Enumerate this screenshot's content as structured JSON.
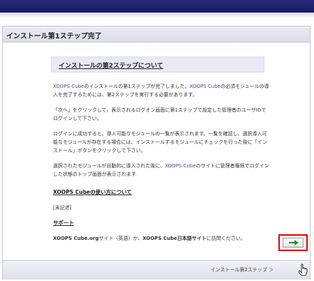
{
  "window": {
    "title": "インストール第1ステップ完了"
  },
  "main": {
    "section_heading": "インストールの第2ステップについて",
    "paragraph1": {
      "a": "XOOPS Cube",
      "b": "のインストールの第1ステップが完了しました。",
      "c": "XOOPS Cube",
      "d": "の必須モジュールの導入を完了するためには、第2ステップを実行する必要があります。"
    },
    "paragraph2": "「次へ」をクリックして、表示されるログオン画面に第1ステップで設定した管理者のユーザIDでログインして下さい。",
    "paragraph3": "ログインに成功すると、導入可能なモジュールの一覧が表示されます。一覧を確認し、選択導入可能なモジュールが存在する場合には、インストールするモジュールにチェックを行った後に「インストール」ボタンをクリックして下さい。",
    "paragraph4": {
      "a": "選択されたモジュールが自動的に導入された後に、",
      "b": "XOOPS Cube",
      "c": "のサイトに管理者権限でログインした状態のトップ画面が表示されます"
    },
    "usage_heading": "XOOPS Cubeの使い方について",
    "usage_text": "[未記述]",
    "support_heading": "サポート",
    "support_text": {
      "a": "XOOPS Cube.org",
      "b": "サイト（英語）か、",
      "c": "XOOPS Cube日本語サイト",
      "d": "に訪問ください。"
    }
  },
  "footer": {
    "next_label": "インストール第2ステップ ＞",
    "next_button_icon": "right-arrow-icon"
  },
  "colors": {
    "top_bar": "#1b1b66",
    "accent_link": "#4a4a9a",
    "highlight_border": "#e00000",
    "arrow": "#2e8b2e"
  }
}
